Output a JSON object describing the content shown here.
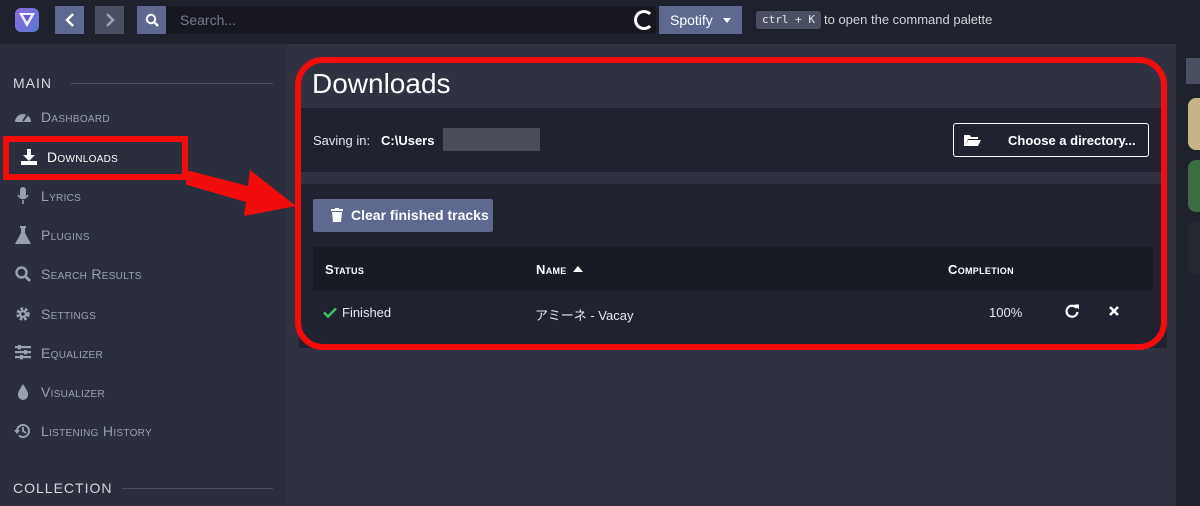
{
  "topbar": {
    "search_placeholder": "Search...",
    "source": "Spotify",
    "shortcut": "ctrl + K",
    "shortcut_hint": "to open the command palette"
  },
  "sidebar": {
    "main_heading": "MAIN",
    "collection_heading": "COLLECTION",
    "items": [
      {
        "label": "Dashboard",
        "icon": "dashboard-icon"
      },
      {
        "label": "Downloads",
        "icon": "download-icon",
        "active": true
      },
      {
        "label": "Lyrics",
        "icon": "microphone-icon"
      },
      {
        "label": "Plugins",
        "icon": "flask-icon"
      },
      {
        "label": "Search Results",
        "icon": "search-icon"
      },
      {
        "label": "Settings",
        "icon": "gear-icon"
      },
      {
        "label": "Equalizer",
        "icon": "sliders-icon"
      },
      {
        "label": "Visualizer",
        "icon": "drop-icon"
      },
      {
        "label": "Listening History",
        "icon": "history-icon"
      }
    ]
  },
  "downloads": {
    "title": "Downloads",
    "saving_label": "Saving in:",
    "saving_path": "C:\\Users",
    "choose_dir_label": "Choose a directory...",
    "clear_label": "Clear finished tracks",
    "columns": {
      "status": "Status",
      "name": "Name",
      "completion": "Completion"
    },
    "rows": [
      {
        "status": "Finished",
        "name": "アミーネ - Vacay",
        "completion": "100%"
      }
    ]
  },
  "colors": {
    "accent": "#5e6891",
    "annotation": "#f20c0c",
    "success": "#3fbf5e"
  }
}
